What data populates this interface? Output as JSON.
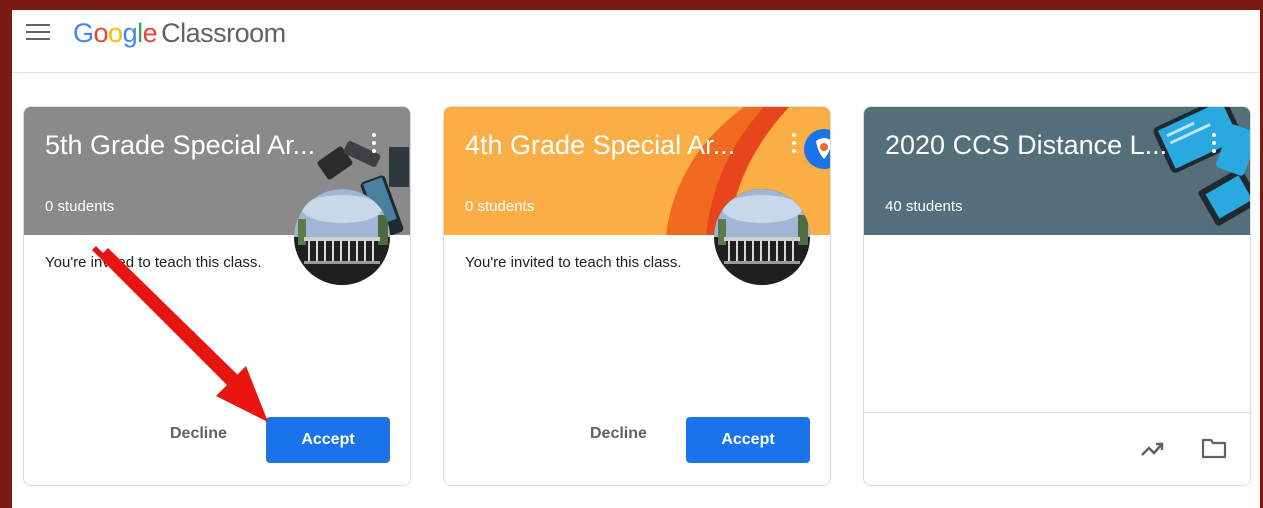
{
  "app": {
    "logo_letters": [
      "G",
      "o",
      "o",
      "g",
      "l",
      "e"
    ],
    "product_name": "Classroom"
  },
  "classes": [
    {
      "title": "5th Grade Special Ar...",
      "students": "0 students",
      "invite_text": "You're invited to teach this class.",
      "decline_label": "Decline",
      "accept_label": "Accept",
      "header_color": "#8a8a8a"
    },
    {
      "title": "4th Grade Special Ar...",
      "students": "0 students",
      "invite_text": "You're invited to teach this class.",
      "decline_label": "Decline",
      "accept_label": "Accept",
      "header_color": "#fbae45"
    },
    {
      "title": "2020 CCS Distance L...",
      "students": "40 students",
      "header_color": "#546e7a",
      "footer_icons": [
        "trending-up-icon",
        "folder-icon"
      ]
    }
  ],
  "colors": {
    "accent": "#1a73e8",
    "annotation_arrow": "#e8140f",
    "frame": "#7a1a12"
  }
}
